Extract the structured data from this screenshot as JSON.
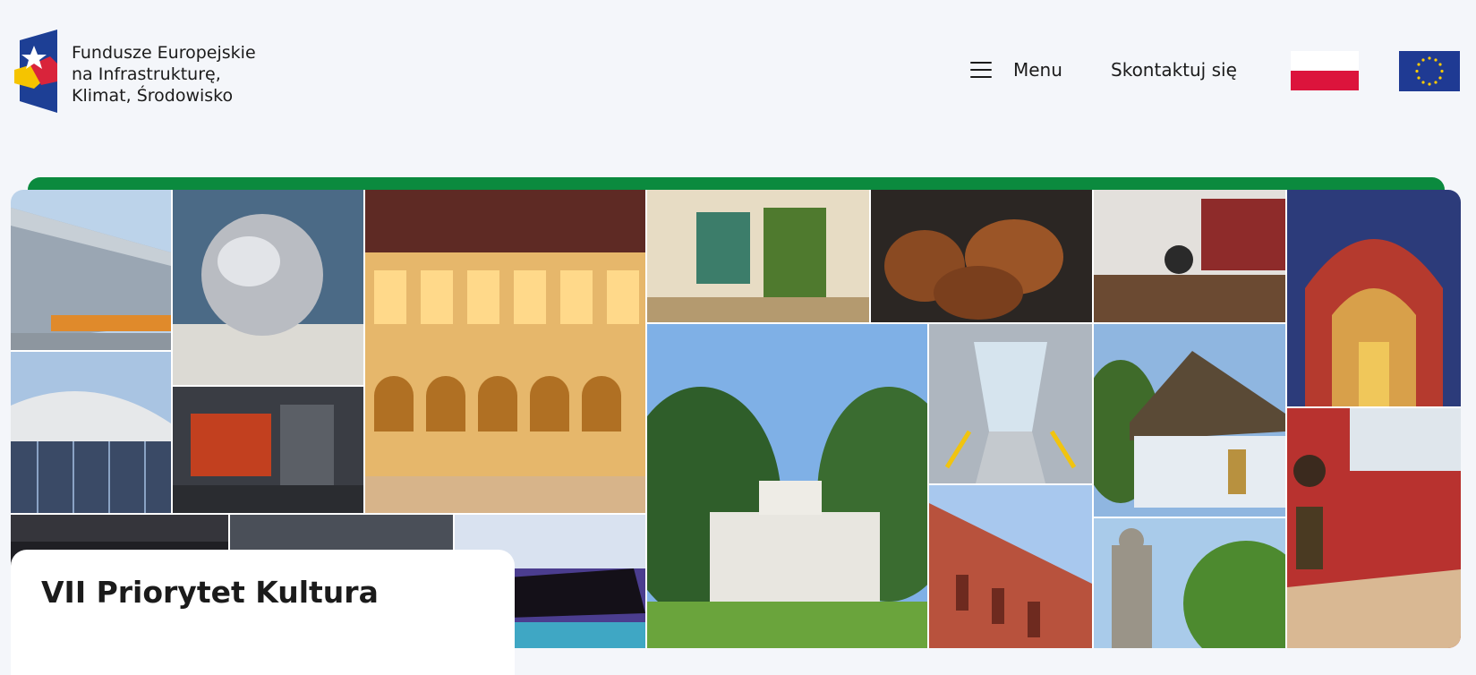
{
  "header": {
    "logo": {
      "icon": "eu-funds-logo-icon",
      "lines": [
        "Fundusze Europejskie",
        "na Infrastrukturę,",
        "Klimat, Środowisko"
      ]
    },
    "menu_label": "Menu",
    "contact_label": "Skontaktuj się",
    "flags": [
      "poland-flag-icon",
      "eu-flag-icon"
    ]
  },
  "colors": {
    "accent_green": "#0b8a3e",
    "logo_blue": "#1d3f95",
    "logo_red": "#d9243b",
    "logo_yellow": "#f5c400",
    "background": "#f4f6fa"
  },
  "banner": {
    "title": "VII Priorytet Kultura"
  }
}
